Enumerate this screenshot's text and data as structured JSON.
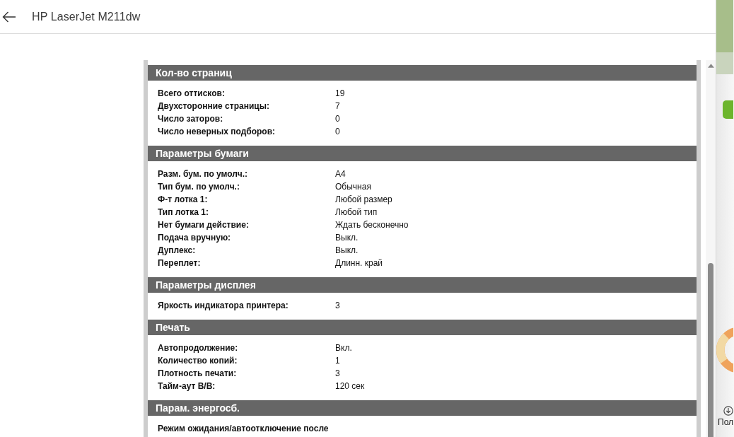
{
  "header": {
    "title": "HP LaserJet M211dw"
  },
  "sections": [
    {
      "title": "Кол-во страниц",
      "rows": [
        {
          "label": "Всего оттисков:",
          "value": "19"
        },
        {
          "label": "Двухсторонние страницы:",
          "value": "7"
        },
        {
          "label": "Число заторов:",
          "value": "0"
        },
        {
          "label": "Число неверных подборов:",
          "value": "0"
        }
      ]
    },
    {
      "title": "Параметры бумаги",
      "rows": [
        {
          "label": "Разм. бум. по умолч.:",
          "value": "A4"
        },
        {
          "label": "Тип бум. по умолч.:",
          "value": "Обычная"
        },
        {
          "label": "Ф-т лотка 1:",
          "value": "Любой размер"
        },
        {
          "label": "Тип лотка 1:",
          "value": "Любой тип"
        },
        {
          "label": "Нет бумаги действие:",
          "value": "Ждать бесконечно"
        },
        {
          "label": "Подача вручную:",
          "value": "Выкл."
        },
        {
          "label": "Дуплекс:",
          "value": "Выкл."
        },
        {
          "label": "Переплет:",
          "value": "Длинн. край"
        }
      ]
    },
    {
      "title": "Параметры дисплея",
      "rows": [
        {
          "label": "Яркость индикатора принтера:",
          "value": "3"
        }
      ]
    },
    {
      "title": "Печать",
      "rows": [
        {
          "label": "Автопродолжение:",
          "value": "Вкл."
        },
        {
          "label": "Количество копий:",
          "value": "1"
        },
        {
          "label": "Плотность печати:",
          "value": "3"
        },
        {
          "label": "Тайм-аут В/В:",
          "value": "120 сек"
        }
      ]
    },
    {
      "title": "Парам. энергосб.",
      "rows": [
        {
          "label": "Режим ожидания/автоотключение после"
        }
      ]
    }
  ],
  "side_panel": {
    "label": "Пол"
  }
}
